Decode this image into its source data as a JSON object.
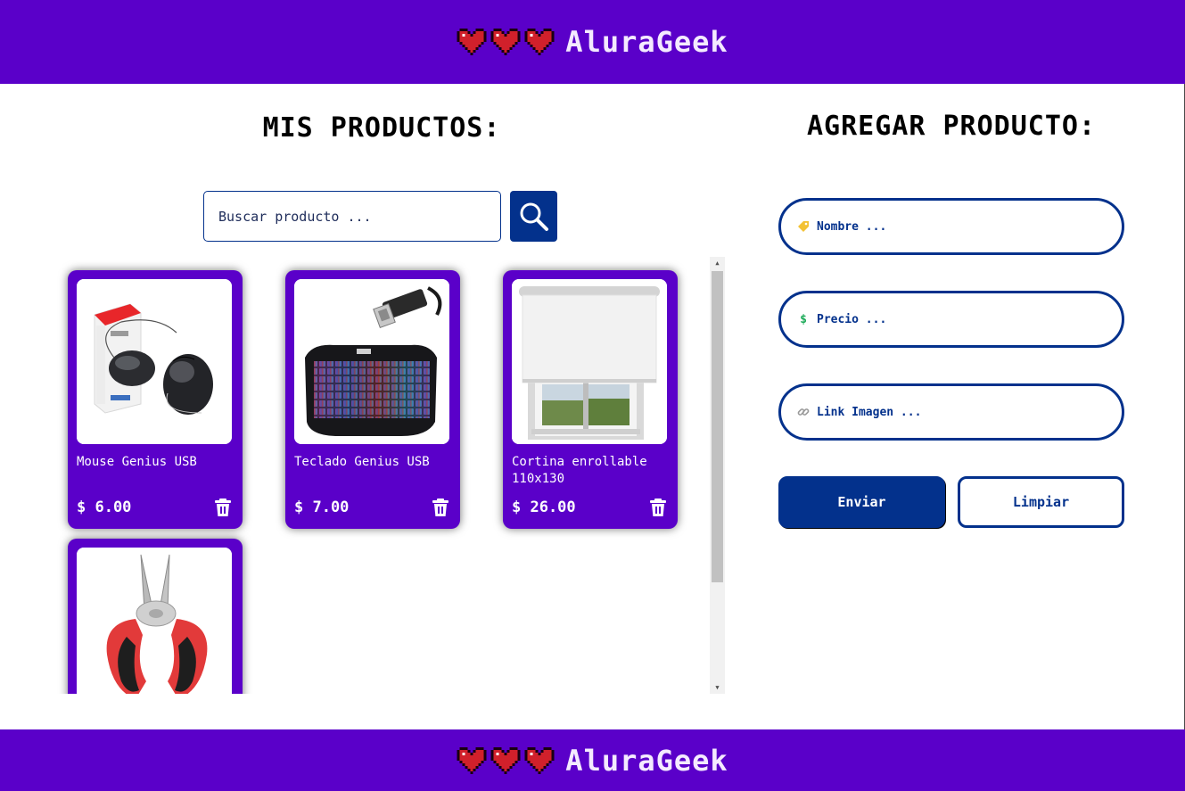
{
  "brand": {
    "name": "AluraGeek",
    "heart_color": "#d1202b"
  },
  "colors": {
    "primary": "#5a00c9",
    "accent": "#03318c"
  },
  "products_section": {
    "title": "MIS PRODUCTOS:",
    "search": {
      "placeholder": "Buscar producto ...",
      "value": "",
      "button_icon": "search-icon"
    },
    "items": [
      {
        "name": "Mouse Genius USB",
        "price": "$ 6.00",
        "image": "mouse-image",
        "delete_icon": "trash-icon"
      },
      {
        "name": "Teclado Genius USB",
        "price": "$ 7.00",
        "image": "keyboard-image",
        "delete_icon": "trash-icon"
      },
      {
        "name": "Cortina enrollable 110x130",
        "price": "$ 26.00",
        "image": "roller-blind-image",
        "delete_icon": "trash-icon"
      },
      {
        "name": "",
        "price": "",
        "image": "pliers-image",
        "delete_icon": "trash-icon"
      }
    ]
  },
  "add_section": {
    "title": "AGREGAR PRODUCTO:",
    "fields": [
      {
        "placeholder": "Nombre ...",
        "value": "",
        "icon": "tag-icon"
      },
      {
        "placeholder": "Precio ...",
        "value": "",
        "icon": "dollar-icon"
      },
      {
        "placeholder": "Link Imagen ...",
        "value": "",
        "icon": "link-icon"
      }
    ],
    "buttons": {
      "send": "Enviar",
      "clear": "Limpiar"
    }
  },
  "footer": {
    "name": "AluraGeek"
  }
}
